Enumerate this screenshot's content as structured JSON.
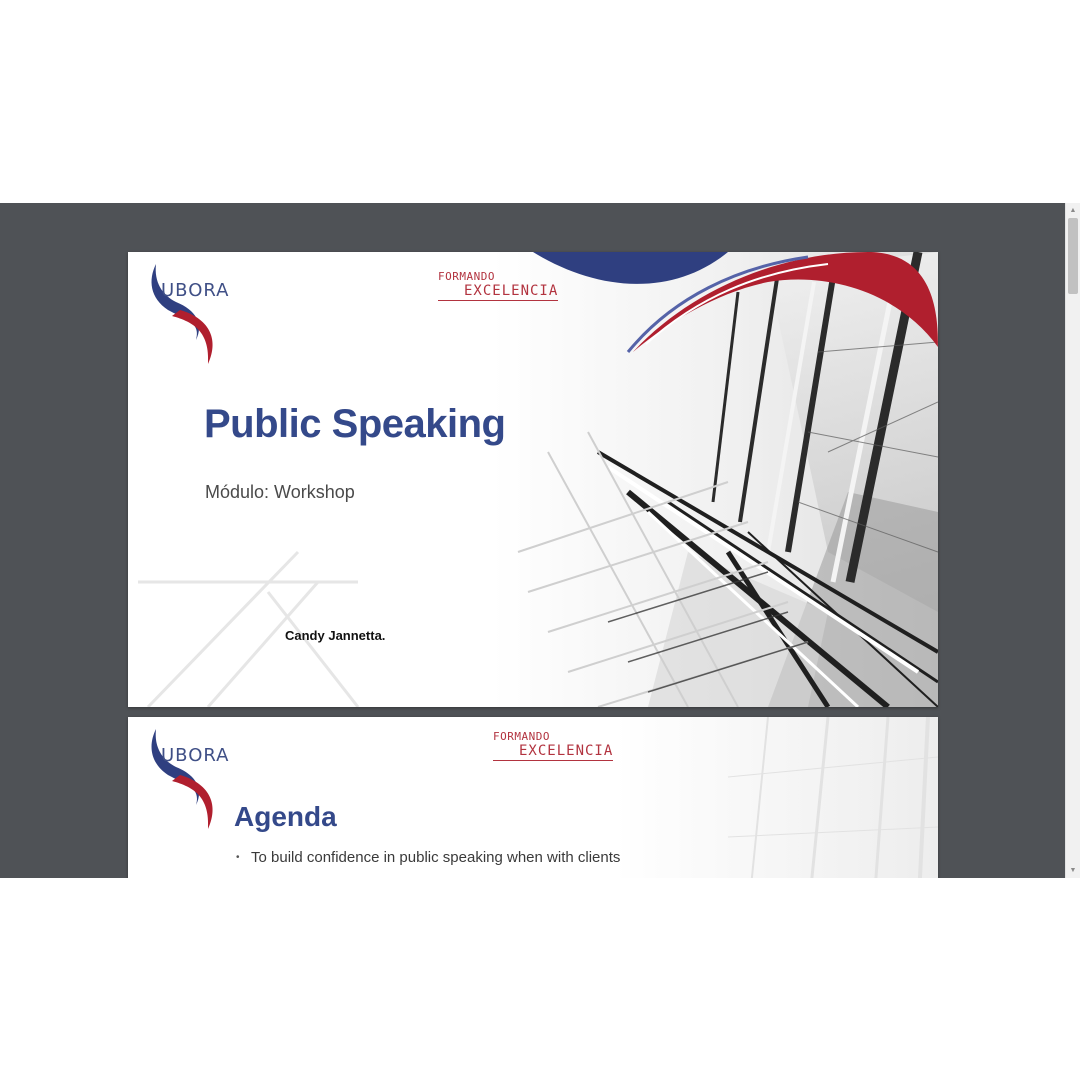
{
  "slides": [
    {
      "logo": "UBORA",
      "brand_top": "FORMANDO",
      "brand_bottom": "EXCELENCIA",
      "title": "Public Speaking",
      "subtitle": "Módulo: Workshop",
      "presenter": "Candy Jannetta."
    },
    {
      "logo": "UBORA",
      "brand_top": "FORMANDO",
      "brand_bottom": "EXCELENCIA",
      "title": "Agenda",
      "bullets": [
        "To build confidence in public speaking when with clients"
      ]
    }
  ],
  "colors": {
    "viewer_background": "#4f5256",
    "title_blue": "#34498a",
    "brand_red": "#b2333f",
    "swoosh_navy": "#2f3f80"
  },
  "icons": {
    "scroll_up": "triangle-up",
    "scroll_down": "triangle-down"
  }
}
